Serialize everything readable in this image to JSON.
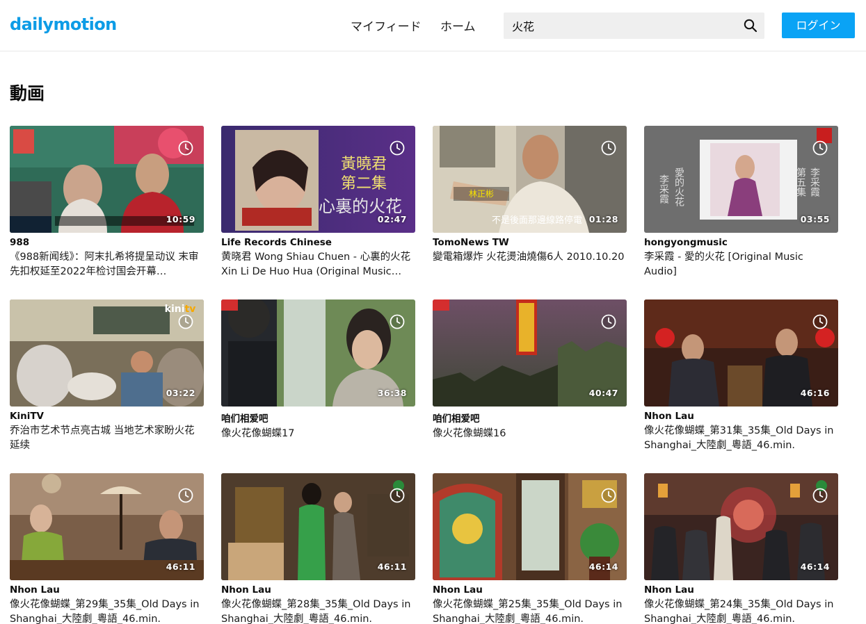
{
  "header": {
    "logo": "dailymotion",
    "nav": [
      "マイフィード",
      "ホーム"
    ],
    "search_value": "火花",
    "login_label": "ログイン"
  },
  "section_title": "動画",
  "videos": [
    {
      "channel": "988",
      "title": "《988新闻线》：阿末扎希将提呈动议 末审先扣权延至2022年检讨国会开幕…",
      "duration": "10:59",
      "theme": "radio"
    },
    {
      "channel": "Life Records Chinese",
      "title": "黄晓君 Wong Shiau Chuen - 心裏的火花 Xin Li De Huo Hua (Original Music…",
      "duration": "02:47",
      "theme": "album-purple",
      "overlay_text": [
        "黃曉君",
        "第二集",
        "心裏的火花"
      ]
    },
    {
      "channel": "TomoNews TW",
      "title": "變電箱爆炸 火花燙油燒傷6人 2010.10.20",
      "duration": "01:28",
      "theme": "street",
      "overlay_text": [
        "林正彬",
        "不是後面那邊線路停電"
      ]
    },
    {
      "channel": "hongyongmusic",
      "title": "李采霞 - 愛的火花 [Original Music Audio]",
      "duration": "03:55",
      "theme": "album-grey",
      "overlay_text": [
        "愛的火花",
        "李采霞",
        "第五集",
        "李采霞"
      ]
    },
    {
      "channel": "KiniTV",
      "title": "乔治市艺术节点亮古城 当地艺术家盼火花延续",
      "duration": "03:22",
      "theme": "cafe",
      "overlay_text": [
        "kini tv"
      ]
    },
    {
      "channel": "咱们相爱吧",
      "title": "像火花像蝴蝶17",
      "duration": "36:38",
      "theme": "drama-garden"
    },
    {
      "channel": "咱们相爱吧",
      "title": "像火花像蝴蝶16",
      "duration": "40:47",
      "theme": "drama-city"
    },
    {
      "channel": "Nhon Lau",
      "title": "像火花像蝴蝶_第31集_35集_Old Days in Shanghai_大陸劇_粵語_46.min.",
      "duration": "46:16",
      "theme": "drama-room-red"
    },
    {
      "channel": "Nhon Lau",
      "title": "像火花像蝴蝶_第29集_35集_Old Days in Shanghai_大陸劇_粵語_46.min.",
      "duration": "46:11",
      "theme": "drama-table"
    },
    {
      "channel": "Nhon Lau",
      "title": "像火花像蝴蝶_第28集_35集_Old Days in Shanghai_大陸劇_粵語_46.min.",
      "duration": "46:11",
      "theme": "drama-bedroom"
    },
    {
      "channel": "Nhon Lau",
      "title": "像火花像蝴蝶_第25集_35集_Old Days in Shanghai_大陸劇_粵語_46.min.",
      "duration": "46:14",
      "theme": "drama-window"
    },
    {
      "channel": "Nhon Lau",
      "title": "像火花像蝴蝶_第24集_35集_Old Days in Shanghai_大陸劇_粵語_46.min.",
      "duration": "46:14",
      "theme": "drama-hall"
    }
  ],
  "colors": {
    "brand": "#0d9ce6",
    "login_bg": "#0aa3f5",
    "search_bg": "#efefef"
  }
}
